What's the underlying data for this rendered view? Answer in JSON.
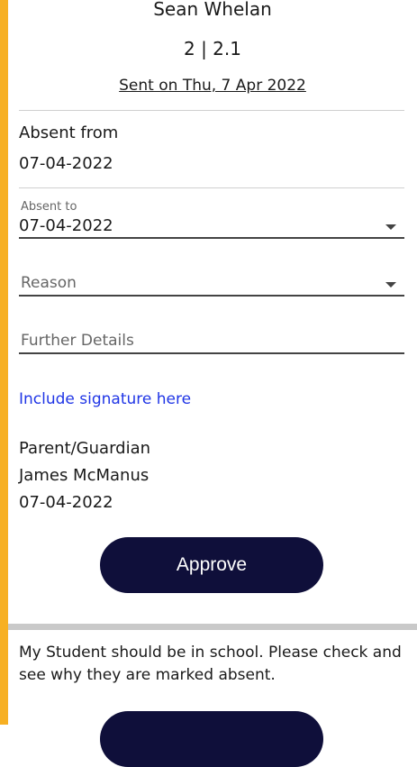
{
  "header": {
    "student_name": "Sean Whelan",
    "class_label": "2 | 2.1",
    "sent_on": "Sent on Thu, 7 Apr 2022"
  },
  "absent_from": {
    "label": "Absent from",
    "value": "07-04-2022"
  },
  "absent_to": {
    "label": "Absent to",
    "value": "07-04-2022"
  },
  "reason": {
    "placeholder": "Reason"
  },
  "further_details": {
    "placeholder": "Further Details"
  },
  "signature_link": "Include signature here",
  "guardian": {
    "label": "Parent/Guardian",
    "name": "James McManus",
    "date": "07-04-2022"
  },
  "approve_label": "Approve",
  "message": "My Student should be in school. Please check and see why they are marked absent.",
  "colors": {
    "accent": "#f7b023",
    "button": "#0f0f3a",
    "link": "#1f35e6"
  }
}
